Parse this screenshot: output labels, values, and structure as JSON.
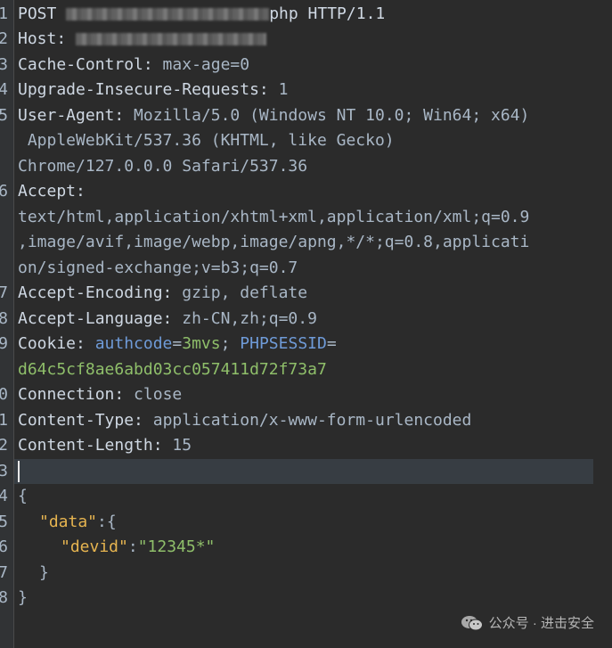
{
  "gutter": [
    "1",
    "2",
    "3",
    "4",
    "5",
    "",
    "",
    "6",
    "",
    "",
    "",
    "7",
    "8",
    "9",
    "",
    "0",
    "1",
    "2",
    "3",
    "4",
    "5",
    "6",
    "7",
    "8"
  ],
  "request": {
    "method": "POST",
    "path_suffix": "php HTTP/1.1",
    "host_key": "Host:",
    "cache_key": "Cache-Control:",
    "cache_val": " max-age=0",
    "upgrade_key": "Upgrade-Insecure-Requests:",
    "upgrade_val": " 1",
    "ua_key": "User-Agent:",
    "ua_val_1": " Mozilla/5.0 (Windows NT 10.0; Win64; x64)",
    "ua_val_2": " AppleWebKit/537.36 (KHTML, like Gecko)",
    "ua_val_3": "Chrome/127.0.0.0 Safari/537.36",
    "accept_key": "Accept:",
    "accept_val_1": "text/html,application/xhtml+xml,application/xml;q=0.9",
    "accept_val_2": ",image/avif,image/webp,image/apng,*/*;q=0.8,applicati",
    "accept_val_3": "on/signed-exchange;v=b3;q=0.7",
    "encoding_key": "Accept-Encoding:",
    "encoding_val": " gzip, deflate",
    "language_key": "Accept-Language:",
    "language_val": " zh-CN,zh;q=0.9",
    "cookie_key": "Cookie:",
    "cookie_name_1": "authcode",
    "cookie_eq": "=",
    "cookie_value_1": "3mvs",
    "cookie_sep": "; ",
    "cookie_name_2": "PHPSESSID",
    "cookie_value_2": "d64c5cf8ae6abd03cc057411d72f73a7",
    "connection_key": "Connection:",
    "connection_val": " close",
    "ctype_key": "Content-Type:",
    "ctype_val": " application/x-www-form-urlencoded",
    "clen_key": "Content-Length:",
    "clen_val": " 15"
  },
  "body": {
    "open": "{",
    "data_key": "\"data\"",
    "colon_open": ":{",
    "devid_key": "\"devid\"",
    "colon": ":",
    "devid_val": "\"12345*\"",
    "inner_close": "}",
    "outer_close": "}"
  },
  "watermark": {
    "text": "公众号 · 进击安全"
  }
}
